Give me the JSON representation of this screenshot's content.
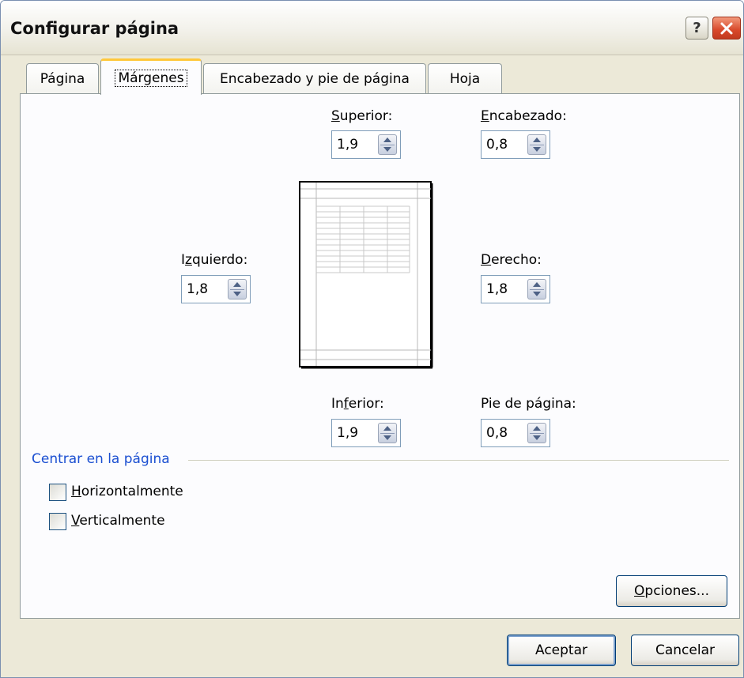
{
  "window": {
    "title": "Configurar página"
  },
  "titlebar": {
    "help_glyph": "?"
  },
  "tabs": [
    {
      "label": "Página",
      "active": false
    },
    {
      "label": "Márgenes",
      "active": true
    },
    {
      "label": "Encabezado y pie de página",
      "active": false
    },
    {
      "label": "Hoja",
      "active": false
    }
  ],
  "margins": {
    "superior": {
      "label_hotkey": "S",
      "label_rest": "uperior:",
      "value": "1,9"
    },
    "encabezado": {
      "label_hotkey": "E",
      "label_rest": "ncabezado:",
      "value": "0,8"
    },
    "izquierdo": {
      "label_pre": "I",
      "label_hotkey": "z",
      "label_rest": "quierdo:",
      "value": "1,8"
    },
    "derecho": {
      "label_hotkey": "D",
      "label_rest": "erecho:",
      "value": "1,8"
    },
    "inferior": {
      "label_pre": "In",
      "label_hotkey": "f",
      "label_rest": "erior:",
      "value": "1,9"
    },
    "pie": {
      "label_pre": "Pie de pá",
      "label_hotkey": "g",
      "label_rest": "ina:",
      "value": "0,8"
    }
  },
  "center": {
    "group_label": "Centrar en la página",
    "horizontal": {
      "hotkey": "H",
      "rest": "orizontalmente",
      "checked": false
    },
    "vertical": {
      "hotkey": "V",
      "rest": "erticalmente",
      "checked": false
    }
  },
  "buttons": {
    "options": {
      "hotkey": "O",
      "rest": "pciones..."
    },
    "accept": "Aceptar",
    "cancel": "Cancelar"
  },
  "colors": {
    "group_title": "#1b4fd1",
    "active_tab_accent": "#ffc83c",
    "close_button": "#d8482a"
  },
  "icons": [
    "help-icon",
    "close-icon",
    "spin-up-arrow-icon",
    "spin-down-arrow-icon",
    "checkbox-icon",
    "page-preview-icon"
  ]
}
